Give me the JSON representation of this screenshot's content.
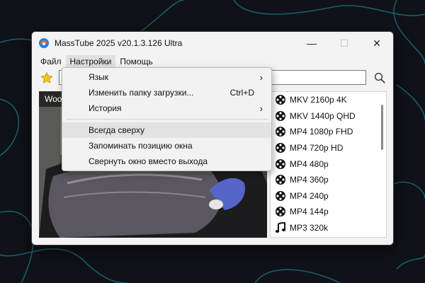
{
  "window": {
    "title": "MassTube 2025 v20.1.3.126 Ultra",
    "controls": {
      "minimize": "—",
      "maximize": "☐",
      "close": "✕"
    }
  },
  "menubar": {
    "items": [
      {
        "label": "Файл"
      },
      {
        "label": "Настройки"
      },
      {
        "label": "Помощь"
      }
    ]
  },
  "toolbar": {
    "url_value": ""
  },
  "video": {
    "title": "Woo"
  },
  "formats": [
    {
      "label": "MKV 2160p 4K",
      "icon": "film-reel-icon"
    },
    {
      "label": "MKV 1440p QHD",
      "icon": "film-reel-icon"
    },
    {
      "label": "MP4 1080p FHD",
      "icon": "film-reel-icon"
    },
    {
      "label": "MP4 720p HD",
      "icon": "film-reel-icon"
    },
    {
      "label": "MP4 480p",
      "icon": "film-reel-icon"
    },
    {
      "label": "MP4 360p",
      "icon": "film-reel-icon"
    },
    {
      "label": "MP4 240p",
      "icon": "film-reel-icon"
    },
    {
      "label": "MP4 144p",
      "icon": "film-reel-icon"
    },
    {
      "label": "MP3 320k",
      "icon": "music-note-icon"
    }
  ],
  "settings_menu": {
    "items": [
      {
        "label": "Язык",
        "submenu": true
      },
      {
        "label": "Изменить папку загрузки...",
        "shortcut": "Ctrl+D"
      },
      {
        "label": "История",
        "submenu": true
      },
      {
        "label": "Всегда сверху",
        "highlighted": true
      },
      {
        "label": "Запоминать позицию окна"
      },
      {
        "label": "Свернуть окно вместо выхода"
      }
    ],
    "arrow": "›"
  },
  "colors": {
    "accent_star": "#f5c518",
    "background": "#0f1218",
    "highlight": "#e3e3e3"
  }
}
